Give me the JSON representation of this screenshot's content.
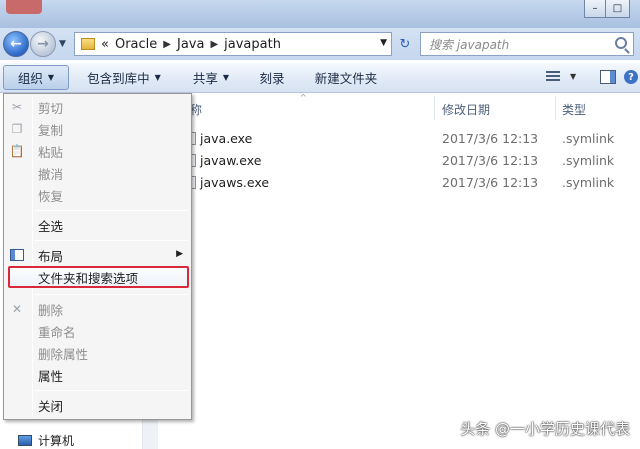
{
  "window": {
    "minimize_glyph": "–",
    "restore_glyph": "□"
  },
  "nav": {
    "back_glyph": "←",
    "forward_glyph": "→",
    "recent_glyph": "▼",
    "breadcrumb": {
      "overflow": "«",
      "items": [
        "Oracle",
        "Java",
        "javapath"
      ],
      "separator": "▶"
    },
    "address_dropdown_glyph": "▼",
    "refresh_glyph": "↻",
    "search_placeholder": "搜索 javapath"
  },
  "toolbar": {
    "organize": "组织",
    "include_in_library": "包含到库中",
    "share": "共享",
    "burn": "刻录",
    "new_folder": "新建文件夹",
    "caret": "▼",
    "help_glyph": "?"
  },
  "file_list": {
    "columns": [
      "称",
      "修改日期",
      "类型"
    ],
    "sort_glyph": "^",
    "rows": [
      {
        "name": "java.exe",
        "modified": "2017/3/6 12:13",
        "type": ".symlink"
      },
      {
        "name": "javaw.exe",
        "modified": "2017/3/6 12:13",
        "type": ".symlink"
      },
      {
        "name": "javaws.exe",
        "modified": "2017/3/6 12:13",
        "type": ".symlink"
      }
    ]
  },
  "organize_menu": {
    "items": [
      {
        "label": "剪切",
        "enabled": false,
        "icon": "scissors-icon"
      },
      {
        "label": "复制",
        "enabled": false,
        "icon": "copy-icon"
      },
      {
        "label": "粘贴",
        "enabled": false,
        "icon": "paste-icon"
      },
      {
        "label": "撤消",
        "enabled": false
      },
      {
        "label": "恢复",
        "enabled": false
      },
      {
        "label": "全选",
        "enabled": true
      },
      {
        "label": "布局",
        "enabled": true,
        "icon": "layout-icon",
        "submenu": true
      },
      {
        "label": "文件夹和搜索选项",
        "enabled": true,
        "highlighted": true,
        "highlight_color": "#d8283a"
      },
      {
        "label": "删除",
        "enabled": false,
        "icon": "delete-x-icon"
      },
      {
        "label": "重命名",
        "enabled": false
      },
      {
        "label": "删除属性",
        "enabled": false
      },
      {
        "label": "属性",
        "enabled": true
      },
      {
        "label": "关闭",
        "enabled": true
      }
    ],
    "submenu_arrow": "▶",
    "scissors_glyph": "✂",
    "copy_glyph": "❐",
    "paste_glyph": "📋",
    "delete_glyph": "✕"
  },
  "sidebar": {
    "computer": "计算机"
  },
  "watermark": "头条 @一小学历史课代表"
}
